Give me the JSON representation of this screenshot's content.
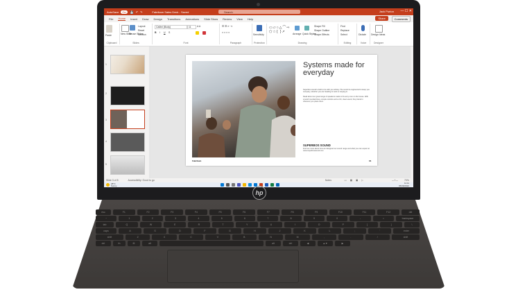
{
  "window": {
    "autosave": "AutoSave",
    "autosave_state": "On",
    "file_title": "Fabrikam Sales Deck - Saved",
    "search_placeholder": "Search",
    "user_name": "Jack Purton",
    "win_controls": "— ☐ ✕"
  },
  "menu": {
    "items": [
      "File",
      "Home",
      "Insert",
      "Draw",
      "Design",
      "Transitions",
      "Animations",
      "Slide Show",
      "Review",
      "View",
      "Help"
    ],
    "active": "Home",
    "share": "Share",
    "comments": "Comments"
  },
  "ribbon": {
    "groups": [
      {
        "label": "Clipboard"
      },
      {
        "label": "Slides"
      },
      {
        "label": "Font"
      },
      {
        "label": "Paragraph"
      },
      {
        "label": "Protection"
      },
      {
        "label": "Drawing"
      },
      {
        "label": "Editing"
      },
      {
        "label": "Voice"
      },
      {
        "label": "Designer"
      }
    ],
    "paste": "Paste",
    "new_slide": "New Slide",
    "reuse_slides": "Reuse Slides",
    "layout": "Layout",
    "reset": "Reset",
    "section": "Section",
    "font_name": "Calibri (Body)",
    "font_size": "11",
    "sensitivity": "Sensitivity",
    "arrange": "Arrange",
    "quick_styles": "Quick Styles",
    "shape_fill": "Shape Fill",
    "shape_outline": "Shape Outline",
    "shape_effects": "Shape Effects",
    "find": "Find",
    "replace": "Replace",
    "select": "Select",
    "dictate": "Dictate",
    "design_ideas": "Design Ideas"
  },
  "thumbnails": {
    "numbers": [
      "1",
      "2",
      "3",
      "4",
      "5"
    ],
    "selected": 3
  },
  "slide": {
    "title": "Systems made for everyday",
    "body": "Superbos sound is built to be with you all day. The sound is engineered to keep you company, whether you are heading to work or staying in.\n\nRead about our great range of speakers made to fit every room in the house. With smooth rounded lines, simple controls and a rich, clear sound, they blend in wherever you place them.",
    "subheading": "SUPERBOS SOUND",
    "sub_body": "Find out more about how we designed our sound range and what you can expect at www.superbossound.com",
    "footer_left": "Fabrikam",
    "footer_right": "04"
  },
  "status": {
    "slide_info": "Slide 3 of 8",
    "accessibility": "Accessibility: Good to go",
    "notes": "Notes",
    "zoom": "70%"
  },
  "taskbar": {
    "weather_temp": "28°C",
    "weather_desc": "Sunny",
    "time": "11:11",
    "date": "05/09/2022"
  },
  "brand": {
    "logo": "hp",
    "accent": "#c43e1c"
  },
  "keyboard": {
    "row1": [
      "esc",
      "F1",
      "F2",
      "F3",
      "F4",
      "F5",
      "F6",
      "F7",
      "F8",
      "F9",
      "F10",
      "F11",
      "F12",
      "del"
    ],
    "row2": [
      "~",
      "1",
      "2",
      "3",
      "4",
      "5",
      "6",
      "7",
      "8",
      "9",
      "0",
      "-",
      "=",
      "backspace"
    ],
    "row3": [
      "tab",
      "Q",
      "W",
      "E",
      "R",
      "T",
      "Y",
      "U",
      "I",
      "O",
      "P",
      "[",
      "]",
      "\\"
    ],
    "row4": [
      "caps",
      "A",
      "S",
      "D",
      "F",
      "G",
      "H",
      "J",
      "K",
      "L",
      ";",
      "'",
      "enter"
    ],
    "row5": [
      "shift",
      "Z",
      "X",
      "C",
      "V",
      "B",
      "N",
      "M",
      ",",
      ".",
      "/",
      "shift"
    ],
    "row6": [
      "ctrl",
      "fn",
      "⊞",
      "alt",
      "",
      "alt",
      "ctrl",
      "◀",
      "▲▼",
      "▶"
    ]
  }
}
